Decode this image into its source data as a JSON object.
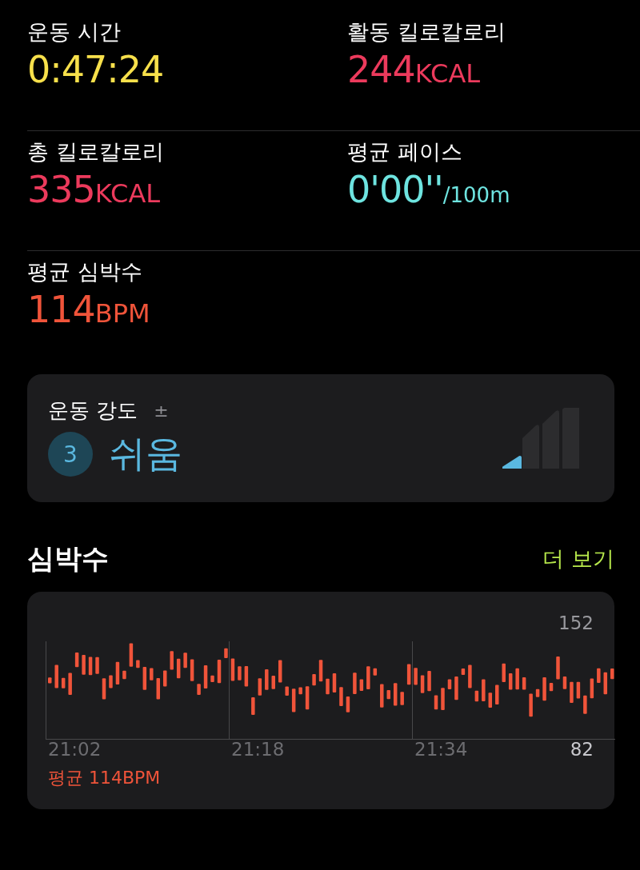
{
  "metrics": [
    {
      "label": "운동 시간",
      "value": "0:47:24",
      "color": "#f7e04b"
    },
    {
      "label": "활동 킬로칼로리",
      "value": "244",
      "unit": "KCAL",
      "color": "#ec3a5c"
    },
    {
      "label": "총 킬로칼로리",
      "value": "335",
      "unit": "KCAL",
      "color": "#ec3a5c"
    },
    {
      "label": "평균 페이스",
      "value": "0'00''",
      "unit": "/100m",
      "color": "#6ee4e0"
    },
    {
      "label": "평균 심박수",
      "value": "114",
      "unit": "BPM",
      "color": "#f0543a"
    }
  ],
  "intensity": {
    "title": "운동 강도",
    "symbol": "±",
    "number": "3",
    "text": "쉬움",
    "level": 0.25
  },
  "heart_rate": {
    "title": "심박수",
    "more": "더 보기",
    "max": "152",
    "min": "82",
    "times": [
      "21:02",
      "21:18",
      "21:34"
    ],
    "average": "평균 114BPM"
  }
}
